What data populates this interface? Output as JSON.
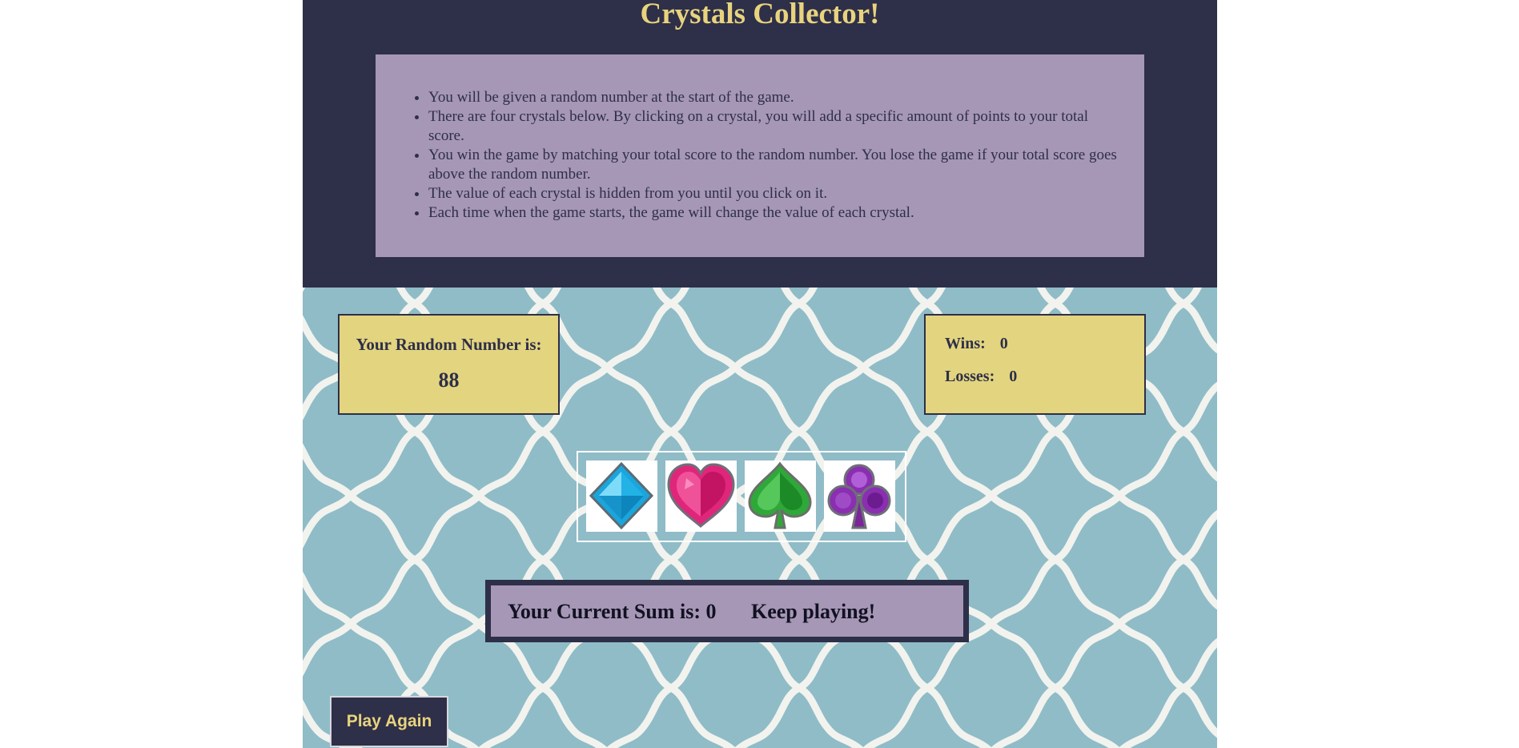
{
  "title": "Crystals Collector!",
  "instructions": [
    "You will be given a random number at the start of the game.",
    "There are four crystals below. By clicking on a crystal, you will add a specific amount of points to your total score.",
    "You win the game by matching your total score to the random number. You lose the game if your total score goes above the random number.",
    "The value of each crystal is hidden from you until you click on it.",
    "Each time when the game starts, the game will change the value of each crystal."
  ],
  "random": {
    "label": "Your Random Number is:",
    "value": "88"
  },
  "score": {
    "wins_label": "Wins:",
    "wins": "0",
    "losses_label": "Losses:",
    "losses": "0"
  },
  "crystals": [
    {
      "icon": "blue-diamond-crystal-icon",
      "color": "#1aa6dc"
    },
    {
      "icon": "pink-heart-crystal-icon",
      "color": "#e0267a"
    },
    {
      "icon": "green-spade-crystal-icon",
      "color": "#2fa83a"
    },
    {
      "icon": "purple-club-crystal-icon",
      "color": "#8a2fb0"
    }
  ],
  "sum": {
    "label": "Your Current Sum is: 0",
    "message": "Keep playing!"
  },
  "play_again_label": "Play Again",
  "colors": {
    "navy": "#2e2f48",
    "gold": "#e8d37e",
    "lavender": "#a697b6",
    "yellow": "#e3d47f",
    "teal": "#8fbcc7"
  }
}
